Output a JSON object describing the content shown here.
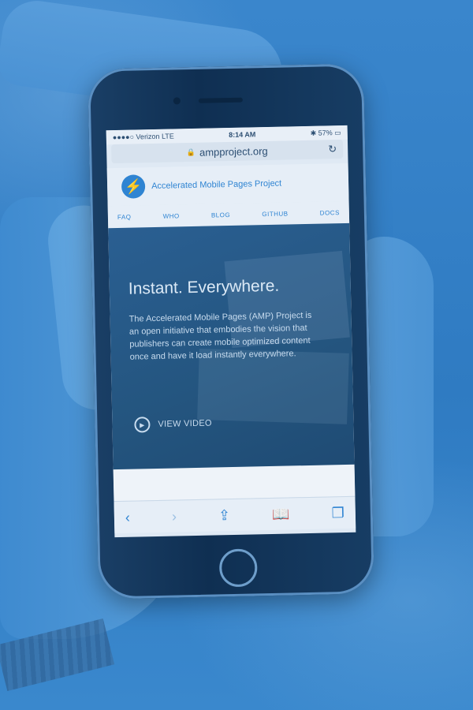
{
  "status_bar": {
    "carrier": "●●●●○ Verizon  LTE",
    "time": "8:14 AM",
    "battery": "57%"
  },
  "url_bar": {
    "lock_icon": "lock-icon",
    "url": "ampproject.org",
    "reload_icon": "reload-icon"
  },
  "site": {
    "logo_icon": "bolt-icon",
    "title": "Accelerated Mobile Pages Project",
    "nav": [
      "FAQ",
      "WHO",
      "BLOG",
      "GITHUB",
      "DOCS"
    ]
  },
  "hero": {
    "title": "Instant. Everywhere.",
    "description": "The Accelerated Mobile Pages (AMP) Project is an open initiative that embodies the vision that publishers can create mobile optimized content once and have it load instantly everywhere.",
    "video_label": "VIEW VIDEO"
  },
  "toolbar": {
    "back": "‹",
    "forward": "›",
    "share": "⇪",
    "bookmarks": "📖",
    "tabs": "❐"
  },
  "colors": {
    "accent": "#2f84d2",
    "overlay": "#2f7fc7"
  }
}
